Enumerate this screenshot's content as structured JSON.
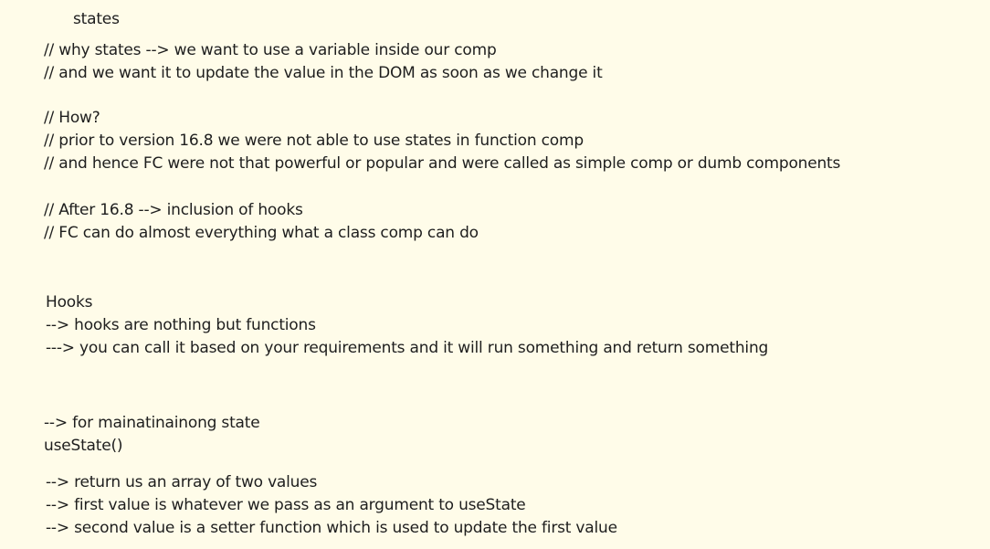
{
  "title": "states",
  "intro": [
    "// why states --> we want to use a variable inside our comp",
    "// and we want it to update the value in the DOM as soon as we change it"
  ],
  "how": [
    "// How?",
    "// prior to version 16.8 we were not able to use states in function comp",
    "// and hence FC were not that powerful or popular and were called as simple comp or dumb components"
  ],
  "after": [
    "// After 16.8 --> inclusion of hooks",
    "// FC can do almost everything what a class comp can do"
  ],
  "hooks": [
    "Hooks",
    "--> hooks are nothing but functions",
    "---> you can call it based on your requirements and it will run something and return something"
  ],
  "usestate": [
    "--> for mainatinainong state",
    "useState()"
  ],
  "returns": [
    "--> return us an array of two values",
    "--> first value is whatever we pass as an argument to useState",
    "--> second value is a setter function which is used to update the first value"
  ]
}
